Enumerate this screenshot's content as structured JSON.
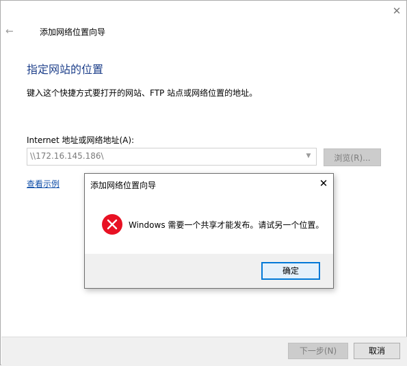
{
  "wizard": {
    "title": "添加网络位置向导",
    "heading": "指定网站的位置",
    "instruction": "键入这个快捷方式要打开的网站、FTP 站点或网络位置的地址。",
    "address_label": "Internet 地址或网络地址(A):",
    "address_value": "\\\\172.16.145.186\\",
    "browse_label": "浏览(R)...",
    "example_link": "查看示例",
    "next_label": "下一步(N)",
    "cancel_label": "取消",
    "icons": {
      "close": "close-icon",
      "back": "back-arrow-icon",
      "dropdown": "chevron-down-icon"
    }
  },
  "dialog": {
    "title": "添加网络位置向导",
    "message": "Windows 需要一个共享才能发布。请试另一个位置。",
    "ok_label": "确定",
    "icon": "error-icon"
  },
  "colors": {
    "heading": "#1d3f8a",
    "link": "#0f4ea8",
    "error_red": "#e81123",
    "focus_border": "#0078d7"
  }
}
